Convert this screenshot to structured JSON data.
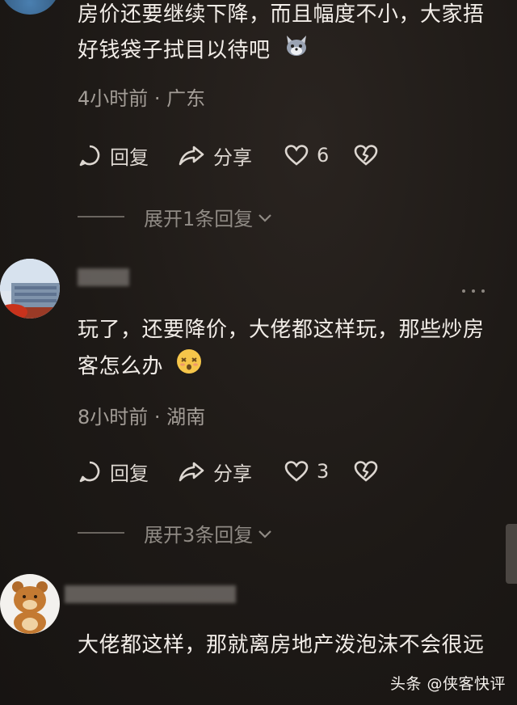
{
  "comments": [
    {
      "text": "房价还要继续下降，而且幅度不小，大家捂好钱袋子拭目以待吧",
      "emoji_icon": "wolf-face-icon",
      "time": "4小时前 · 广东",
      "actions": {
        "reply": "回复",
        "share": "分享",
        "like_count": "6"
      },
      "expand_label": "展开1条回复"
    },
    {
      "text": "玩了，还要降价，大佬都这样玩，那些炒房客怎么办",
      "emoji_icon": "dizzy-face-icon",
      "time": "8小时前 · 湖南",
      "actions": {
        "reply": "回复",
        "share": "分享",
        "like_count": "3"
      },
      "expand_label": "展开3条回复"
    },
    {
      "text": "大佬都这样，那就离房地产泼泡沫不会很远"
    }
  ],
  "watermark": "头条 @侠客快评",
  "colors": {
    "background": "#1f1b19",
    "text": "#f2ede8",
    "meta": "#a39d97"
  }
}
